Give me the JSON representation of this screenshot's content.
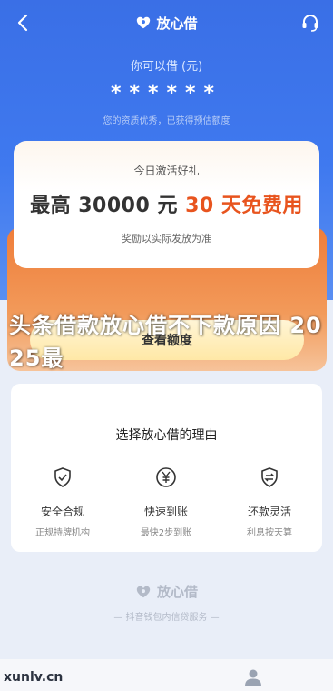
{
  "nav": {
    "title": "放心借",
    "back_icon": "chevron-left-icon",
    "service_icon": "headset-icon"
  },
  "limit": {
    "label": "你可以借 (元)",
    "masked_value": "******",
    "sub": "您的资质优秀，已获得预估额度"
  },
  "promo": {
    "title": "今日激活好礼",
    "main_prefix": "最高 30000 元 ",
    "main_highlight": "30 天免费用",
    "note": "奖励以实际发放为准"
  },
  "action": {
    "check_label": "查看额度"
  },
  "overlay": {
    "text": "头条借款放心借不下款原因 2025最"
  },
  "reasons": {
    "title": "选择放心借的理由",
    "items": [
      {
        "name": "安全合规",
        "desc": "正规持牌机构",
        "icon": "shield-check-icon"
      },
      {
        "name": "快速到账",
        "desc": "最快2步到账",
        "icon": "yuan-icon"
      },
      {
        "name": "还款灵活",
        "desc": "利息按天算",
        "icon": "exchange-shield-icon"
      }
    ]
  },
  "footer": {
    "logo_text": "放心借",
    "desc": "— 抖音钱包内信贷服务 —"
  },
  "bottom": {
    "watermark": "xunlv.cn",
    "user_icon": "user-icon"
  },
  "colors": {
    "brand_blue": "#3f79ef",
    "accent_orange": "#e8541e",
    "button_yellow": "#ffe8a6"
  }
}
